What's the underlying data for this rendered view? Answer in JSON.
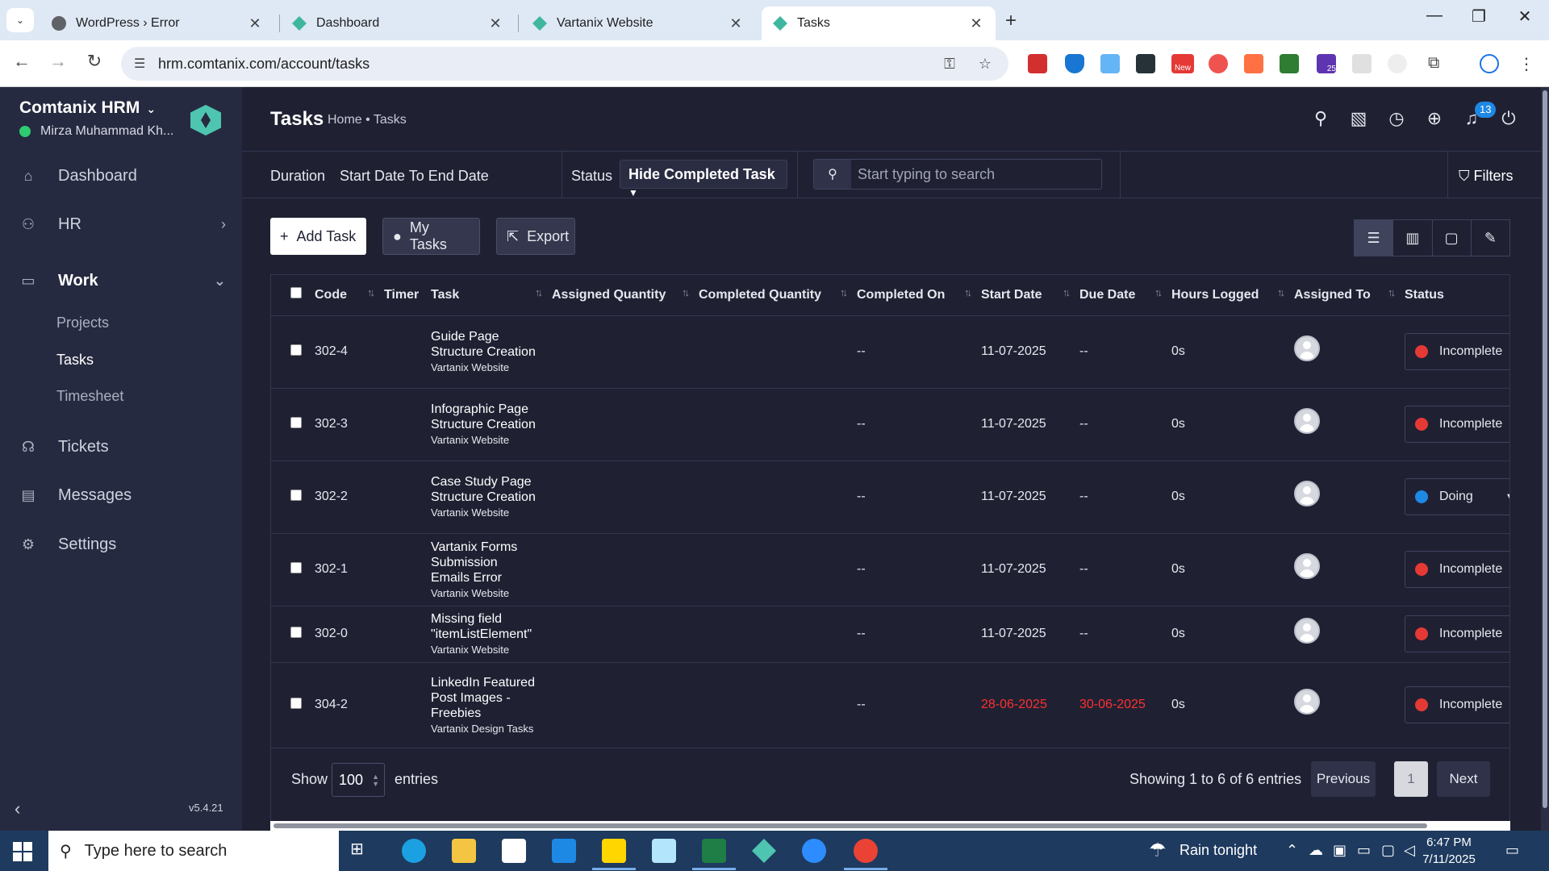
{
  "browser": {
    "tabs": [
      {
        "label": "WordPress › Error",
        "icon": "wordpress-icon",
        "active": false
      },
      {
        "label": "Dashboard",
        "icon": "comtanix-icon",
        "active": false
      },
      {
        "label": "Vartanix Website",
        "icon": "comtanix-icon",
        "active": false
      },
      {
        "label": "Tasks",
        "icon": "comtanix-icon",
        "active": true
      }
    ],
    "url": "hrm.comtanix.com/account/tasks",
    "new_badge": "New",
    "ext_badge": "25",
    "tab_close": "✕",
    "new_tab": "+"
  },
  "sidebar": {
    "brand": "Comtanix HRM",
    "user": "Mirza Muhammad Kh...",
    "items": [
      {
        "label": "Dashboard",
        "icon": "home-icon"
      },
      {
        "label": "HR",
        "icon": "users-icon"
      },
      {
        "label": "Work",
        "icon": "briefcase-icon"
      },
      {
        "label": "Tickets",
        "icon": "headset-icon"
      },
      {
        "label": "Messages",
        "icon": "chat-icon"
      },
      {
        "label": "Settings",
        "icon": "gear-icon"
      }
    ],
    "work_sub": [
      "Projects",
      "Tasks",
      "Timesheet"
    ],
    "version": "v5.4.21"
  },
  "header": {
    "title": "Tasks",
    "breadcrumb": "Home • Tasks",
    "notification_count": "13"
  },
  "filters": {
    "duration_label": "Duration",
    "duration_value": "Start Date To End Date",
    "status_label": "Status",
    "status_value": "Hide Completed Task",
    "search_placeholder": "Start typing to search",
    "filters_label": "Filters"
  },
  "actions": {
    "add_task": "Add Task",
    "my_tasks": "My Tasks",
    "export": "Export"
  },
  "table": {
    "columns": [
      "Code",
      "Timer",
      "Task",
      "Assigned Quantity",
      "Completed Quantity",
      "Completed On",
      "Start Date",
      "Due Date",
      "Hours Logged",
      "Assigned To",
      "Status"
    ],
    "rows": [
      {
        "code": "302-4",
        "task": "Guide Page Structure Creation",
        "project": "Vartanix Website",
        "completed_on": "--",
        "start": "11-07-2025",
        "due": "--",
        "hours": "0s",
        "status": "Incomplete",
        "status_color": "#e53935",
        "overdue": false
      },
      {
        "code": "302-3",
        "task": "Infographic Page Structure Creation",
        "project": "Vartanix Website",
        "completed_on": "--",
        "start": "11-07-2025",
        "due": "--",
        "hours": "0s",
        "status": "Incomplete",
        "status_color": "#e53935",
        "overdue": false
      },
      {
        "code": "302-2",
        "task": "Case Study Page Structure Creation",
        "project": "Vartanix Website",
        "completed_on": "--",
        "start": "11-07-2025",
        "due": "--",
        "hours": "0s",
        "status": "Doing",
        "status_color": "#1e88e5",
        "overdue": false
      },
      {
        "code": "302-1",
        "task": "Vartanix Forms Submission Emails Error",
        "project": "Vartanix Website",
        "completed_on": "--",
        "start": "11-07-2025",
        "due": "--",
        "hours": "0s",
        "status": "Incomplete",
        "status_color": "#e53935",
        "overdue": false
      },
      {
        "code": "302-0",
        "task": "Missing field \"itemListElement\"",
        "project": "Vartanix Website",
        "completed_on": "--",
        "start": "11-07-2025",
        "due": "--",
        "hours": "0s",
        "status": "Incomplete",
        "status_color": "#e53935",
        "overdue": false
      },
      {
        "code": "304-2",
        "task": "LinkedIn Featured Post Images - Freebies",
        "project": "Vartanix Design Tasks",
        "completed_on": "--",
        "start": "28-06-2025",
        "due": "30-06-2025",
        "hours": "0s",
        "status": "Incomplete",
        "status_color": "#e53935",
        "overdue": true
      }
    ]
  },
  "footer": {
    "show_label": "Show",
    "page_size": "100",
    "entries_label": "entries",
    "showing": "Showing 1 to 6 of 6 entries",
    "previous": "Previous",
    "current_page": "1",
    "next": "Next"
  },
  "taskbar": {
    "search_placeholder": "Type here to search",
    "weather": "Rain tonight",
    "time": "6:47 PM",
    "date": "7/11/2025"
  }
}
